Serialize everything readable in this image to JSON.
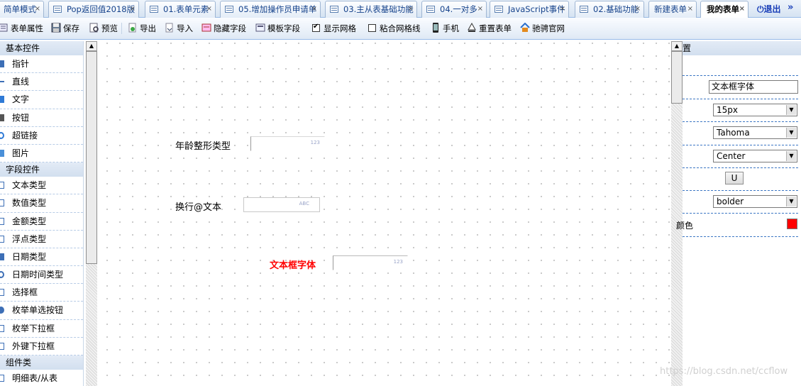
{
  "tabs": [
    {
      "label": "简单模式",
      "active": false
    },
    {
      "label": "Pop返回值2018版",
      "active": false
    },
    {
      "label": "01.表单元素",
      "active": false
    },
    {
      "label": "05.增加操作员申请单",
      "active": false
    },
    {
      "label": "03.主从表基础功能",
      "active": false
    },
    {
      "label": "04.一对多",
      "active": false
    },
    {
      "label": "JavaScript事件",
      "active": false
    },
    {
      "label": "02.基础功能",
      "active": false
    },
    {
      "label": "新建表单",
      "active": false
    },
    {
      "label": "我的表单",
      "active": true
    }
  ],
  "tab_close_glyph": "×",
  "logout_label": "退出",
  "more_tabs_glyph": "»",
  "toolbar": {
    "form_props": "表单属性",
    "save": "保存",
    "preview": "预览",
    "export": "导出",
    "import": "导入",
    "hide_field": "隐藏字段",
    "template_field": "模板字段",
    "show_grid": "显示网格",
    "show_grid_checked": true,
    "snap_grid": "粘合网格线",
    "snap_grid_checked": false,
    "mobile": "手机",
    "reset_form": "重置表单",
    "official_site": "驰骋官网"
  },
  "palette": {
    "basic_title": "基本控件",
    "basic_items": [
      "指针",
      "直线",
      "文字",
      "按钮",
      "超链接",
      "图片"
    ],
    "field_title": "字段控件",
    "field_items": [
      "文本类型",
      "数值类型",
      "金额类型",
      "浮点类型",
      "日期类型",
      "日期时间类型",
      "选择框",
      "枚举单选按钮",
      "枚举下拉框",
      "外键下拉框"
    ],
    "component_title": "组件类",
    "component_items": [
      "明细表/从表"
    ]
  },
  "canvas": {
    "field1_label": "年龄整形类型",
    "field1_hint": "123",
    "field2_label": "换行@文本",
    "field2_hint": "ABC",
    "field3_label": "文本框字体",
    "field3_hint": "123",
    "field3_label_color": "#ff0000"
  },
  "props": {
    "header_partial": "置",
    "name_value": "文本框字体",
    "font_size": "15px",
    "font_family": "Tahoma",
    "align": "Center",
    "underline_btn": "U",
    "font_weight": "bolder",
    "color_label_partial": "颜色",
    "color_value": "#ff0000"
  },
  "watermark": "https://blog.csdn.net/ccflow"
}
